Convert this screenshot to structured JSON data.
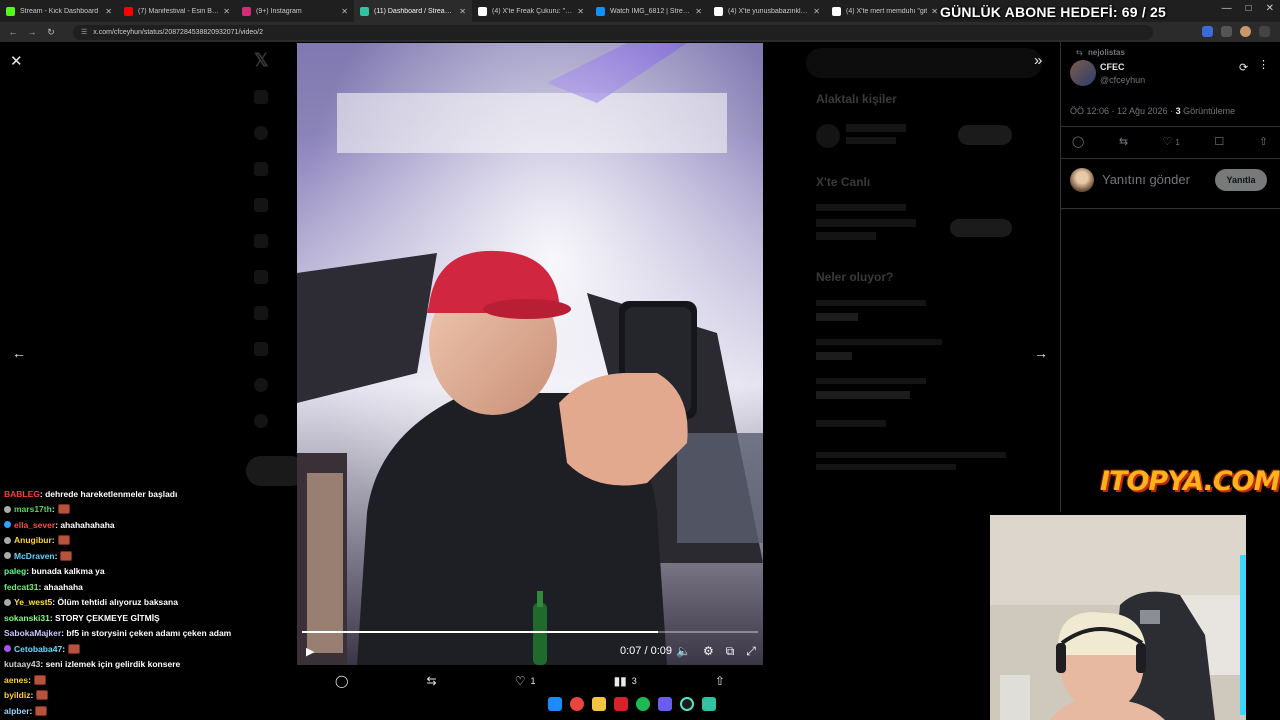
{
  "browser": {
    "tabs": [
      {
        "label": "Stream - Kick Dashboard",
        "color": "#53fc18",
        "active": false
      },
      {
        "label": "(7) Manifestival - Esin Baha",
        "color": "#ff0000",
        "active": false
      },
      {
        "label": "(9+) Instagram",
        "color": "#d62976",
        "active": false
      },
      {
        "label": "(11) Dashboard / Streamlabs",
        "color": "#31c3a2",
        "active": true
      },
      {
        "label": "(4) X'te Freak Çukuru: \"Derbed",
        "color": "#ffffff",
        "active": false
      },
      {
        "label": "Watch IMG_6812 | Streamable",
        "color": "#0f90fa",
        "active": false
      },
      {
        "label": "(4) X'te yunusbabazinkl: \"https:",
        "color": "#ffffff",
        "active": false
      },
      {
        "label": "(4) X'te mert memduhı \"git",
        "color": "#ffffff",
        "active": false
      }
    ],
    "url": "x.com/cfceyhun/status/2087284538820932071/video/2"
  },
  "overlay": {
    "sub_goal": "GÜNLÜK ABONE HEDEFİ: 69 / 25",
    "sponsor_logo_text": "ITOPYA.COM"
  },
  "video": {
    "time": "0:07 / 0:09",
    "progress": 0.78
  },
  "viewer_actions": {
    "like_count": "1",
    "views_count": "3"
  },
  "tweet": {
    "reposted_by": "nejolistas",
    "display_name": "CFEC",
    "handle": "@cfceyhun",
    "time": "ÖÖ 12:06 · 12 Ağu 2026 · ",
    "views": "3",
    "views_label": " Görüntüleme",
    "like_count": "1",
    "reply_placeholder": "Yanıtını gönder",
    "reply_button": "Yanıtla"
  },
  "chat": [
    {
      "user": "BABLEG",
      "color": "#ff3b3b",
      "msg": ": dehrede hareketlenmeler başladı",
      "emote": false,
      "badge": ""
    },
    {
      "user": "mars17th",
      "color": "#4cd964",
      "msg": ": ",
      "emote": true,
      "badge": "#aaaaaa"
    },
    {
      "user": "ella_sever",
      "color": "#ff4d4d",
      "msg": ": ahahahahaha",
      "emote": false,
      "badge": "#3aa0ff"
    },
    {
      "user": "Anugibur",
      "color": "#ffd23a",
      "msg": ": ",
      "emote": true,
      "badge": "#aaaaaa"
    },
    {
      "user": "McDraven",
      "color": "#5ad4ff",
      "msg": ": ",
      "emote": true,
      "badge": "#aaaaaa"
    },
    {
      "user": "paleg",
      "color": "#5dff8a",
      "msg": ": bunada kalkma ya",
      "emote": false,
      "badge": ""
    },
    {
      "user": "fedcat31",
      "color": "#6ef06e",
      "msg": ": ahaahaha",
      "emote": false,
      "badge": ""
    },
    {
      "user": "Ye_west5",
      "color": "#ffe14a",
      "msg": ": Ölüm tehtidi alıyoruz baksana",
      "emote": false,
      "badge": "#aaaaaa"
    },
    {
      "user": "sokanski31",
      "color": "#7dff7d",
      "msg": ": STORY ÇEKMEYE GİTMİŞ",
      "emote": false,
      "badge": ""
    },
    {
      "user": "SabokaMajker",
      "color": "#c9c9ff",
      "msg": ": bf5 in storysini çeken adamı çeken adam",
      "emote": false,
      "badge": ""
    },
    {
      "user": "Cetobaba47",
      "color": "#5de0ff",
      "msg": ": ",
      "emote": true,
      "badge": "#a855f7"
    },
    {
      "user": "kutaay43",
      "color": "#d0d0d0",
      "msg": ": seni izlemek için gelirdik konsere",
      "emote": false,
      "badge": ""
    },
    {
      "user": "aenes",
      "color": "#ffcf3a",
      "msg": ": ",
      "emote": true,
      "badge": ""
    },
    {
      "user": "byildiz",
      "color": "#ffcf3a",
      "msg": ": ",
      "emote": true,
      "badge": ""
    },
    {
      "user": "alpber",
      "color": "#9ad0ff",
      "msg": ": ",
      "emote": true,
      "badge": ""
    }
  ],
  "dim_page": {
    "who_to_follow": "Alaktalı kişiler",
    "happening": "X'te Canlı",
    "trends": "Neler oluyor?"
  }
}
